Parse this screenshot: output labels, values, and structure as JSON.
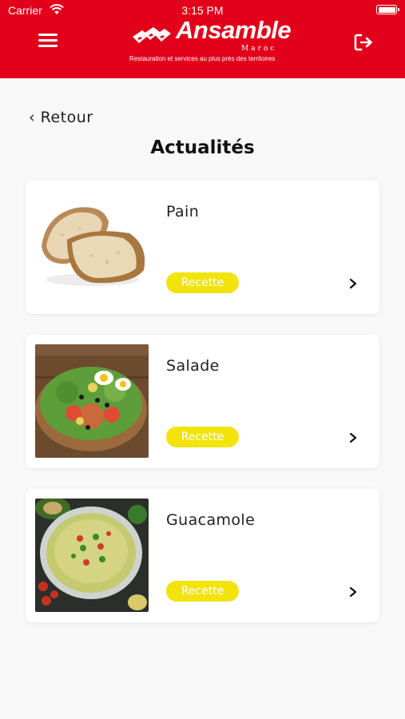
{
  "status_bar": {
    "carrier": "Carrier",
    "time": "3:15 PM",
    "battery_level": 1.0
  },
  "header": {
    "logo_name": "Ansamble",
    "logo_sub": "Maroc",
    "logo_tagline": "Restauration et services au plus près des territoires",
    "menu_icon": "hamburger-menu-icon",
    "logout_icon": "logout-icon",
    "background_color": "#e2001a"
  },
  "nav": {
    "back_label": "‹ Retour"
  },
  "page": {
    "title": "Actualités"
  },
  "items": [
    {
      "title": "Pain",
      "badge": "Recette",
      "image": "bread-image",
      "chevron": "chevron-right-icon"
    },
    {
      "title": "Salade",
      "badge": "Recette",
      "image": "salad-image",
      "chevron": "chevron-right-icon"
    },
    {
      "title": "Guacamole",
      "badge": "Recette",
      "image": "guacamole-image",
      "chevron": "chevron-right-icon"
    }
  ],
  "colors": {
    "accent": "#e2001a",
    "badge": "#f2e30a",
    "background": "#f8f8f8",
    "card": "#ffffff"
  }
}
